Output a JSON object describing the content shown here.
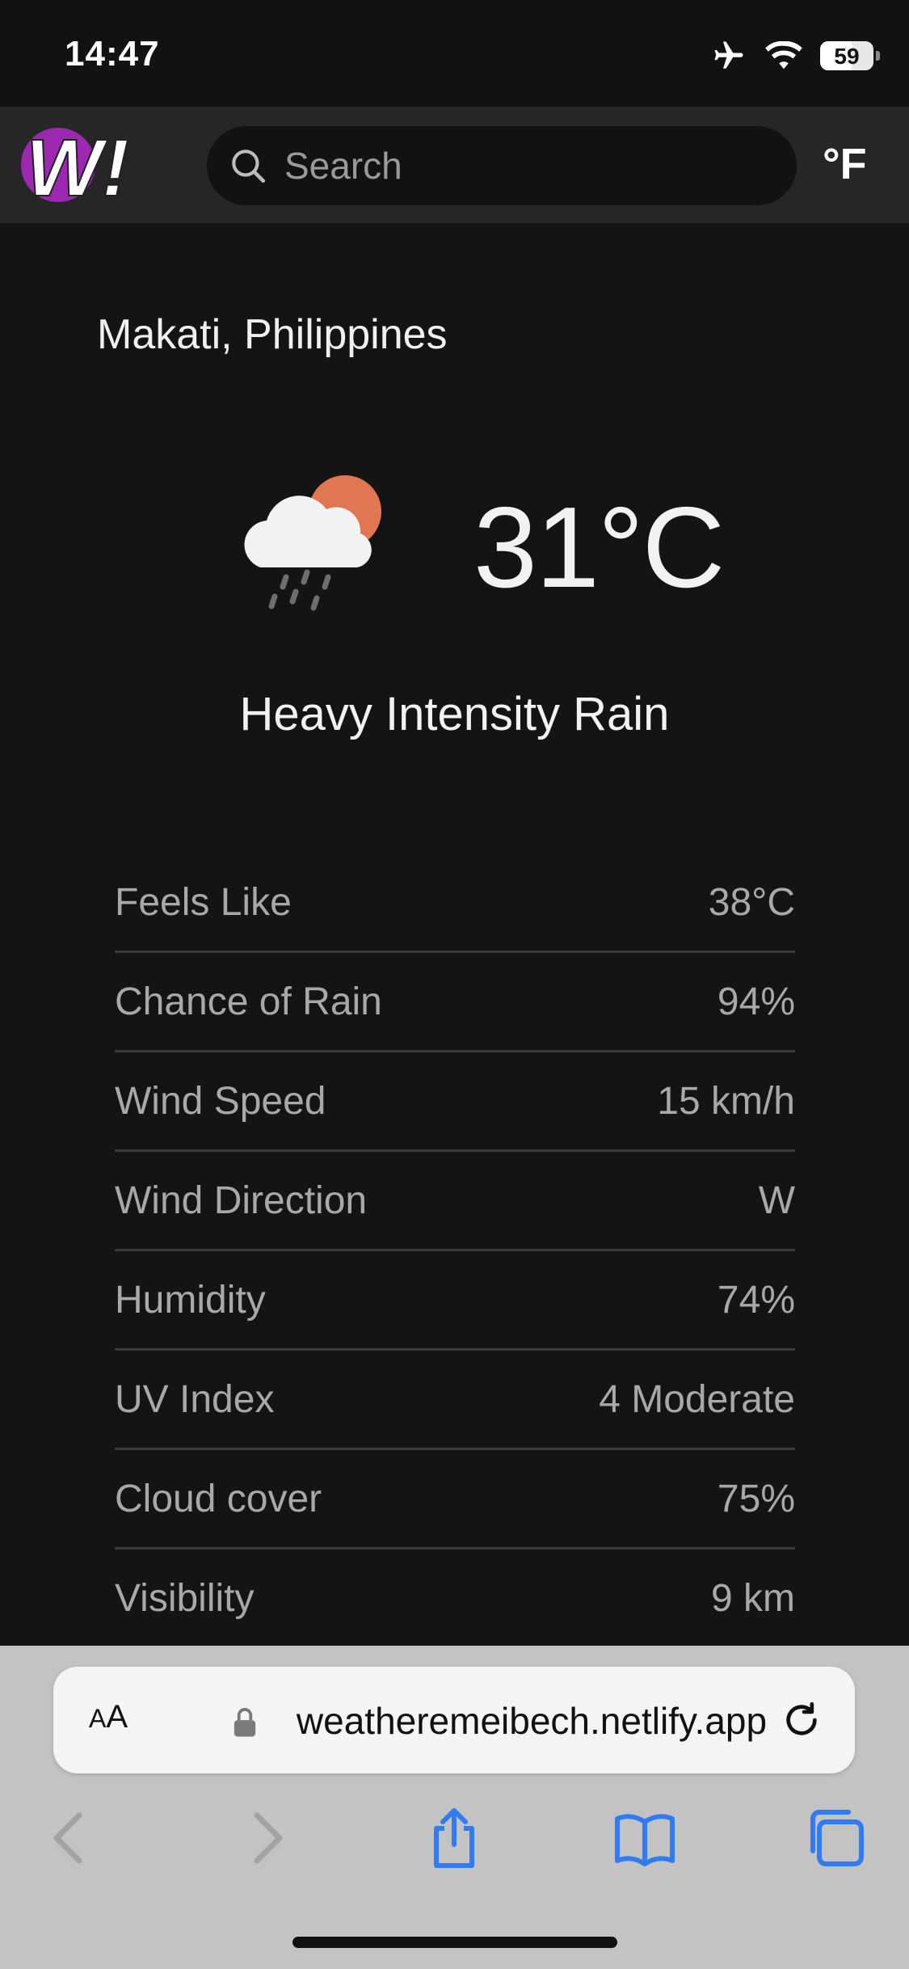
{
  "status_bar": {
    "time": "14:47",
    "battery": "59",
    "battery_level": 0.59,
    "icons": [
      "airplane-icon",
      "wifi-icon",
      "battery-icon"
    ]
  },
  "header": {
    "logo_text": "W!",
    "search_placeholder": "Search",
    "unit_toggle": "°F",
    "accent_color": "#9c27b0"
  },
  "weather": {
    "location": "Makati, Philippines",
    "temperature": "31°C",
    "condition": "Heavy Intensity Rain",
    "icon": "rain-cloud-sun-icon",
    "details": [
      {
        "label": "Feels Like",
        "value": "38°C"
      },
      {
        "label": "Chance of Rain",
        "value": "94%"
      },
      {
        "label": "Wind Speed",
        "value": "15 km/h"
      },
      {
        "label": "Wind Direction",
        "value": "W"
      },
      {
        "label": "Humidity",
        "value": "74%"
      },
      {
        "label": "UV Index",
        "value": "4 Moderate"
      },
      {
        "label": "Cloud cover",
        "value": "75%"
      },
      {
        "label": "Visibility",
        "value": "9 km"
      }
    ]
  },
  "browser": {
    "aa_label_small": "A",
    "aa_label_large": "A",
    "url": "weatheremeibech.netlify.app",
    "toolbar_icons": [
      "back-icon",
      "forward-icon",
      "share-icon",
      "bookmarks-icon",
      "tabs-icon"
    ],
    "link_color": "#2f7cf6"
  }
}
